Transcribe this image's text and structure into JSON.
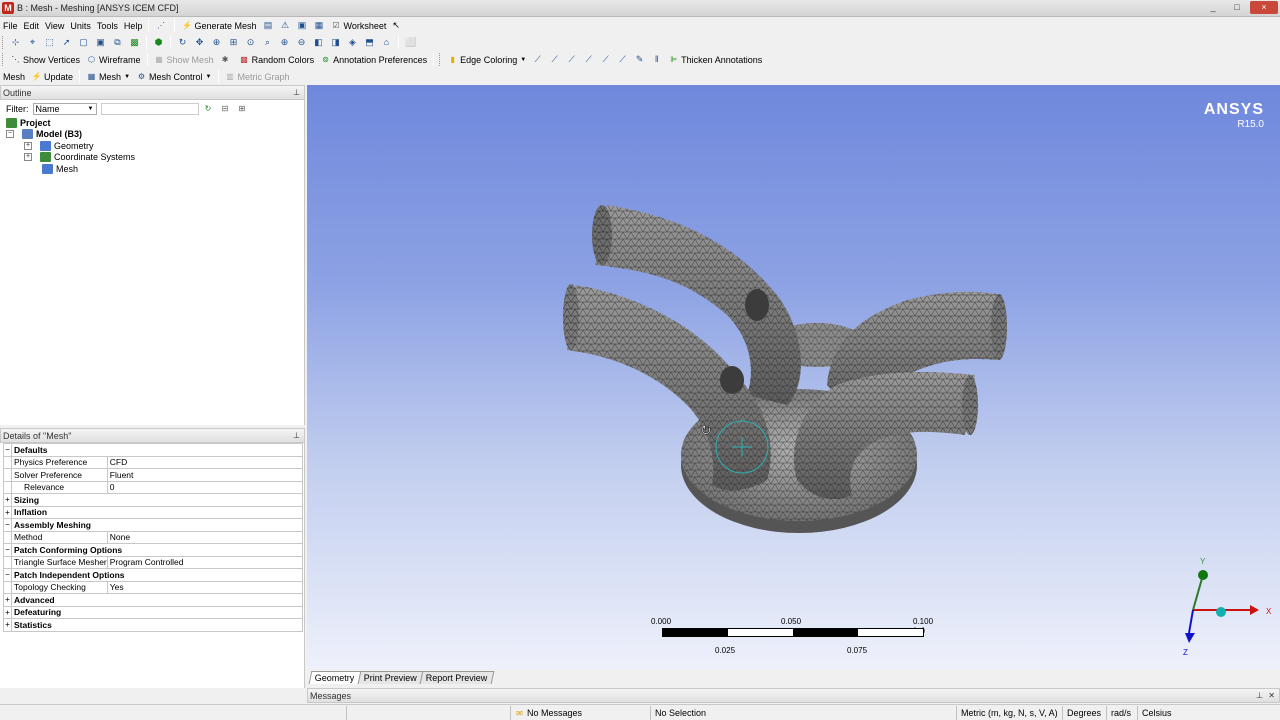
{
  "window": {
    "title": "B : Mesh - Meshing [ANSYS ICEM CFD]",
    "buttons": [
      "_",
      "□",
      "×"
    ]
  },
  "menu": {
    "items": [
      "File",
      "Edit",
      "View",
      "Units",
      "Tools",
      "Help"
    ],
    "generate_mesh": "Generate Mesh",
    "worksheet": "Worksheet"
  },
  "toolbar3": {
    "show_vertices": "Show Vertices",
    "wireframe": "Wireframe",
    "show_mesh": "Show Mesh",
    "random_colors": "Random Colors",
    "annotation_prefs": "Annotation Preferences",
    "edge_coloring": "Edge Coloring",
    "thicken_annotations": "Thicken Annotations"
  },
  "toolbar4": {
    "mesh": "Mesh",
    "update": "Update",
    "mesh_dropdown": "Mesh",
    "mesh_control": "Mesh Control",
    "metric_graph": "Metric Graph"
  },
  "outline": {
    "header": "Outline",
    "filter_label": "Filter:",
    "filter_value": "Name",
    "tree": [
      {
        "label": "Project",
        "level": 0,
        "bold": true
      },
      {
        "label": "Model (B3)",
        "level": 1,
        "bold": true
      },
      {
        "label": "Geometry",
        "level": 2
      },
      {
        "label": "Coordinate Systems",
        "level": 2
      },
      {
        "label": "Mesh",
        "level": 2
      }
    ]
  },
  "details": {
    "header": "Details of \"Mesh\"",
    "rows": [
      {
        "group": "Defaults",
        "toggle": "−"
      },
      {
        "name": "Physics Preference",
        "value": "CFD"
      },
      {
        "name": "Solver Preference",
        "value": "Fluent"
      },
      {
        "name": "Relevance",
        "value": "0",
        "indent": true
      },
      {
        "group": "Sizing",
        "toggle": "+"
      },
      {
        "group": "Inflation",
        "toggle": "+"
      },
      {
        "group": "Assembly Meshing",
        "toggle": "−"
      },
      {
        "name": "Method",
        "value": "None"
      },
      {
        "group": "Patch Conforming Options",
        "toggle": "−"
      },
      {
        "name": "Triangle Surface Mesher",
        "value": "Program Controlled"
      },
      {
        "group": "Patch Independent Options",
        "toggle": "−"
      },
      {
        "name": "Topology Checking",
        "value": "Yes"
      },
      {
        "group": "Advanced",
        "toggle": "+"
      },
      {
        "group": "Defeaturing",
        "toggle": "+"
      },
      {
        "group": "Statistics",
        "toggle": "+"
      }
    ]
  },
  "viewport": {
    "logo": "ANSYS",
    "version": "R15.0",
    "scale_top": [
      "0.000",
      "0.050",
      "0.100 (m)"
    ],
    "scale_bottom": [
      "0.025",
      "0.075"
    ],
    "axis_labels": [
      "Y",
      "X",
      "Z"
    ]
  },
  "tabs": [
    "Geometry",
    "Print Preview",
    "Report Preview"
  ],
  "messages": {
    "header": "Messages"
  },
  "status": {
    "messages": "No Messages",
    "selection": "No Selection",
    "units": "Metric (m, kg, N, s, V, A)",
    "angle": "Degrees",
    "rate": "rad/s",
    "temp": "Celsius"
  },
  "colors": {
    "viewport_top": "#6f88dc",
    "viewport_bottom": "#eef1fb",
    "mesh_body": "#8a8a8a",
    "axis_x": "#cc1111",
    "axis_y": "#118811",
    "axis_z": "#1111cc"
  }
}
